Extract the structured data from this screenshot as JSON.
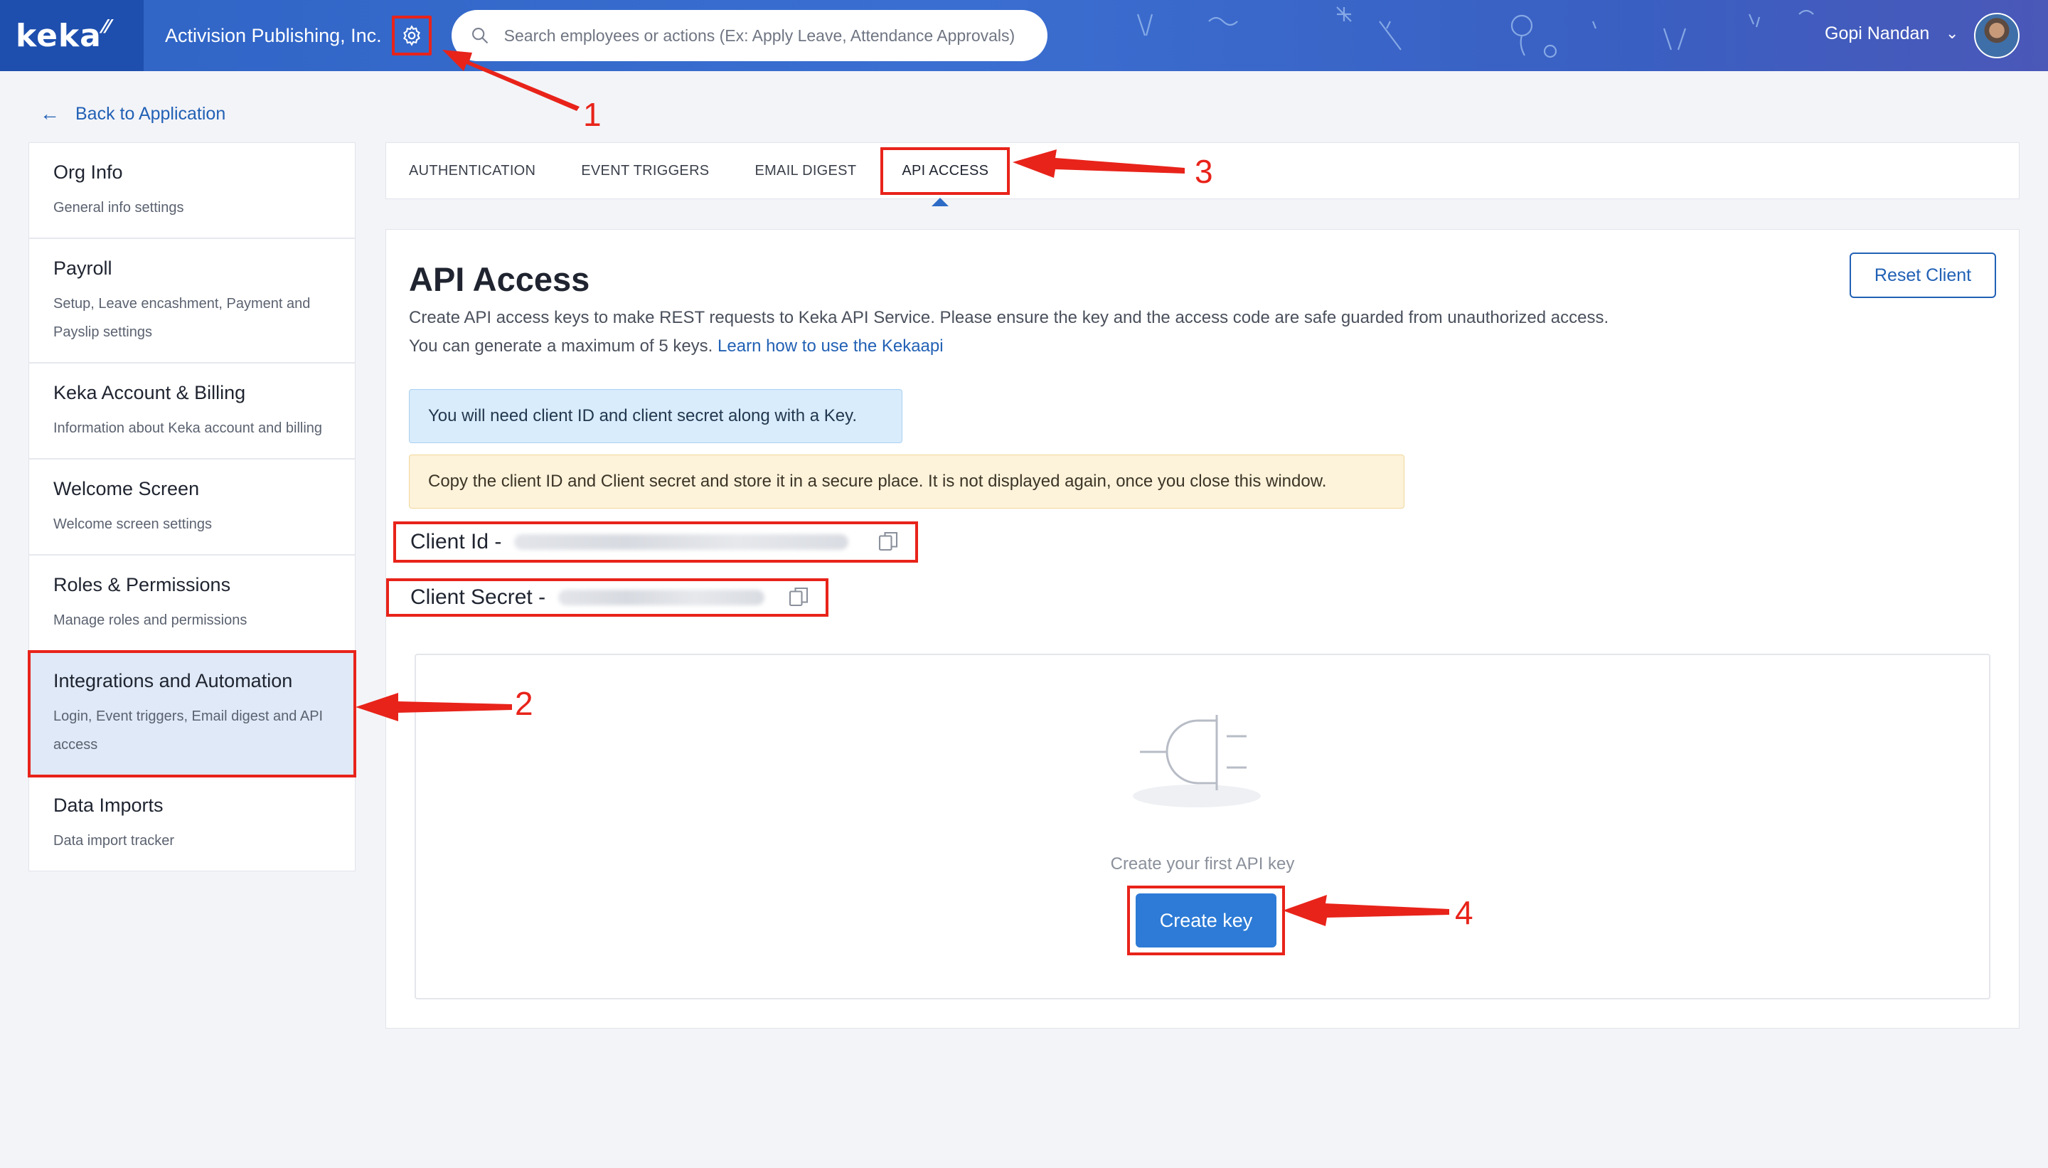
{
  "header": {
    "logo_text": "keka",
    "org_name": "Activision Publishing, Inc.",
    "search_placeholder": "Search employees or actions (Ex: Apply Leave, Attendance Approvals)",
    "user_name": "Gopi Nandan",
    "colors": {
      "bar": "#3a6fd1",
      "logo_bg": "#1e4fae"
    }
  },
  "back_link": "Back to Application",
  "sidebar": {
    "items": [
      {
        "title": "Org Info",
        "desc": "General info settings"
      },
      {
        "title": "Payroll",
        "desc": "Setup, Leave encashment, Payment and Payslip settings"
      },
      {
        "title": "Keka Account & Billing",
        "desc": "Information about Keka account and billing"
      },
      {
        "title": "Welcome Screen",
        "desc": "Welcome screen settings"
      },
      {
        "title": "Roles & Permissions",
        "desc": "Manage roles and permissions"
      },
      {
        "title": "Integrations and Automation",
        "desc": "Login, Event triggers, Email digest and API access",
        "active": true
      },
      {
        "title": "Data Imports",
        "desc": "Data import tracker"
      }
    ]
  },
  "tabs": [
    {
      "label": "AUTHENTICATION"
    },
    {
      "label": "EVENT TRIGGERS"
    },
    {
      "label": "EMAIL DIGEST"
    },
    {
      "label": "API ACCESS",
      "active": true
    }
  ],
  "main": {
    "title": "API Access",
    "reset_button": "Reset Client",
    "description": "Create API access keys to make REST requests to Keka API Service. Please ensure the key and the access code are safe guarded from unauthorized access. You can generate a maximum of 5 keys.",
    "learn_link": "Learn how to use the Kekaapi",
    "info_alert": "You will need client ID and client secret along with a Key.",
    "warn_alert": "Copy the client ID and Client secret and store it in a secure place. It is not displayed again, once you close this window.",
    "client_id_label": "Client Id -",
    "client_secret_label": "Client Secret -",
    "empty_text": "Create your first API key",
    "create_button": "Create key"
  },
  "annotations": {
    "n1": "1",
    "n2": "2",
    "n3": "3",
    "n4": "4",
    "color": "#e8231a"
  }
}
